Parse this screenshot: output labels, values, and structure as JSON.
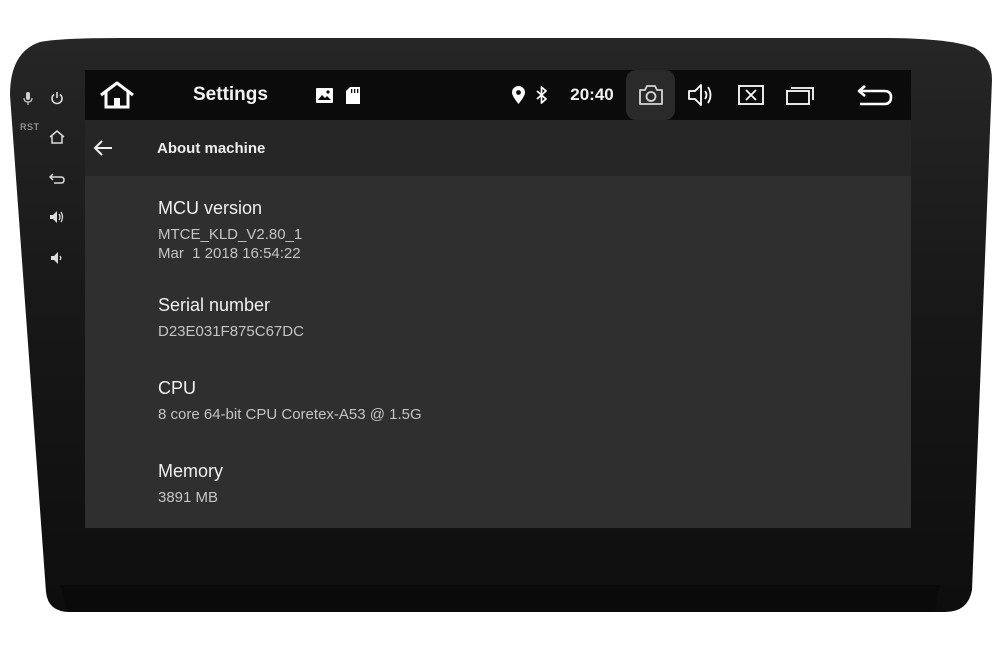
{
  "side_panel": {
    "rst_label": "RST",
    "buttons": [
      {
        "icon": "microphone-icon"
      },
      {
        "icon": "power-icon"
      },
      {
        "icon": "home-icon"
      },
      {
        "icon": "back-icon"
      },
      {
        "icon": "volume-up-icon"
      },
      {
        "icon": "volume-down-icon"
      }
    ]
  },
  "statusbar": {
    "home_icon": "home-icon",
    "title": "Settings",
    "notification_icons": [
      "image-icon",
      "sd-card-icon"
    ],
    "location_icon": "location-pin-icon",
    "bluetooth_icon": "bluetooth-icon",
    "time": "20:40",
    "actions": [
      "camera-icon",
      "volume-icon",
      "close-window-icon",
      "recent-apps-icon",
      "return-icon"
    ]
  },
  "appbar": {
    "back_icon": "arrow-left-icon",
    "title": "About machine"
  },
  "info": {
    "mcu": {
      "title": "MCU version",
      "value_line1": "MTCE_KLD_V2.80_1",
      "value_line2": "Mar  1 2018 16:54:22"
    },
    "serial": {
      "title": "Serial number",
      "value": "D23E031F875C67DC"
    },
    "cpu": {
      "title": "CPU",
      "value": "8 core 64-bit CPU Coretex-A53 @ 1.5G"
    },
    "memory": {
      "title": "Memory",
      "value": "3891 MB"
    }
  },
  "colors": {
    "statusbar_bg": "#0b0b0b",
    "appbar_bg": "#262626",
    "content_bg": "#2f2f2f",
    "bezel": "#1a1a1a"
  }
}
